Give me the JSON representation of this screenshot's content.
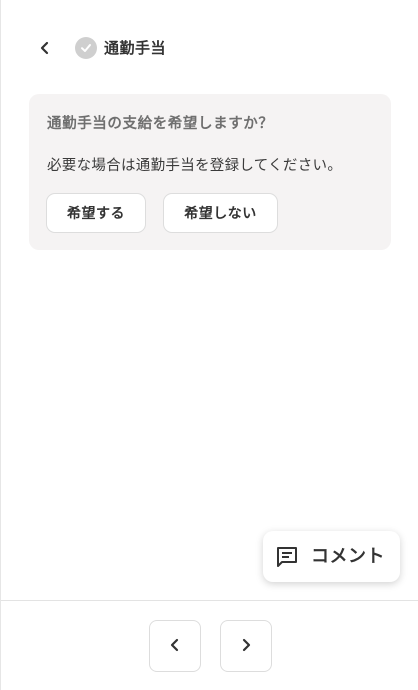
{
  "header": {
    "title": "通勤手当",
    "back_icon": "chevron-left-icon",
    "status_icon": "check-circle-icon",
    "status_color": "#cfcfcf"
  },
  "card": {
    "question": "通勤手当の支給を希望しますか？",
    "description": "必要な場合は通勤手当を登録してください。",
    "yes_label": "希望する",
    "no_label": "希望しない",
    "background": "#f5f3f3"
  },
  "comment": {
    "label": "コメント",
    "icon": "comment-icon"
  },
  "navigation": {
    "prev_icon": "chevron-left-icon",
    "next_icon": "chevron-right-icon"
  }
}
